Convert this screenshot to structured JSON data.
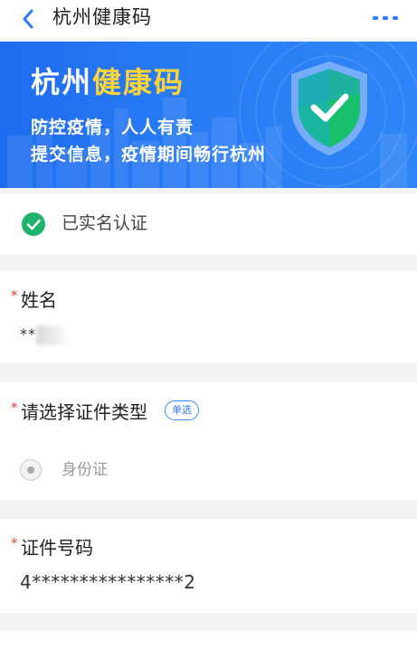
{
  "header": {
    "title": "杭州健康码"
  },
  "banner": {
    "brand_part1": "杭州",
    "brand_part2": "健康码",
    "line1": "防控疫情，人人有责",
    "line2": "提交信息，疫情期间畅行杭州",
    "icons": {
      "shield": "shield-check-icon"
    }
  },
  "verification": {
    "status_text": "已实名认证",
    "icon": "check-circle-icon"
  },
  "form": {
    "required_mark": "*",
    "name": {
      "label": "姓名",
      "value": "**"
    },
    "id_type": {
      "label": "请选择证件类型",
      "badge": "单选",
      "options": [
        {
          "label": "身份证",
          "selected": true
        }
      ]
    },
    "id_number": {
      "label": "证件号码",
      "value": "4****************2"
    }
  },
  "colors": {
    "accent": "#2f7cf6",
    "banner_blue": "#2a7df5",
    "brand_yellow": "#ffd439",
    "success_green": "#1fb36b",
    "required_red": "#e8443a"
  }
}
